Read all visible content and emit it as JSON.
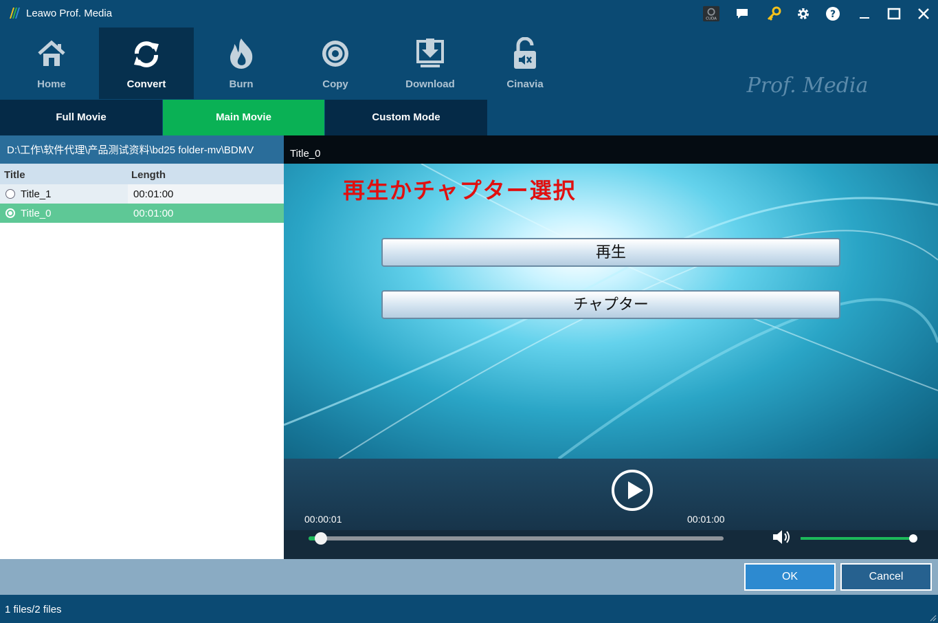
{
  "app": {
    "title": "Leawo Prof. Media"
  },
  "brand": {
    "text": "Prof. Media"
  },
  "titlebar": {
    "icons": [
      "cuda-icon",
      "feedback-icon",
      "register-key-icon",
      "settings-gear-icon",
      "help-icon",
      "minimize-icon",
      "maximize-icon",
      "close-icon"
    ],
    "cuda_label": "CUDA"
  },
  "toolbar": {
    "items": [
      {
        "label": "Home",
        "icon": "home-icon"
      },
      {
        "label": "Convert",
        "icon": "convert-icon",
        "active": true
      },
      {
        "label": "Burn",
        "icon": "burn-icon"
      },
      {
        "label": "Copy",
        "icon": "copy-icon"
      },
      {
        "label": "Download",
        "icon": "download-icon"
      },
      {
        "label": "Cinavia",
        "icon": "cinavia-icon"
      }
    ]
  },
  "modes": {
    "items": [
      {
        "label": "Full Movie"
      },
      {
        "label": "Main Movie",
        "active": true
      },
      {
        "label": "Custom Mode"
      }
    ]
  },
  "source": {
    "path": "D:\\工作\\软件代理\\产品测试资料\\bd25 folder-mv\\BDMV",
    "columns": [
      "Title",
      "Length"
    ],
    "rows": [
      {
        "title": "Title_1",
        "length": "00:01:00",
        "selected": false
      },
      {
        "title": "Title_0",
        "length": "00:01:00",
        "selected": true
      }
    ]
  },
  "player": {
    "title": "Title_0",
    "menu": {
      "heading": "再生かチャプター選択",
      "buttons": [
        "再生",
        "チャプター"
      ]
    },
    "current_time": "00:00:01",
    "total_time": "00:01:00",
    "progress": 0.03,
    "volume": 1.0
  },
  "actions": {
    "ok": "OK",
    "cancel": "Cancel"
  },
  "status": {
    "text": "1 files/2 files"
  },
  "colors": {
    "accent_green": "#0ab155",
    "selected_row": "#5ec896",
    "chrome": "#0b4a73"
  }
}
